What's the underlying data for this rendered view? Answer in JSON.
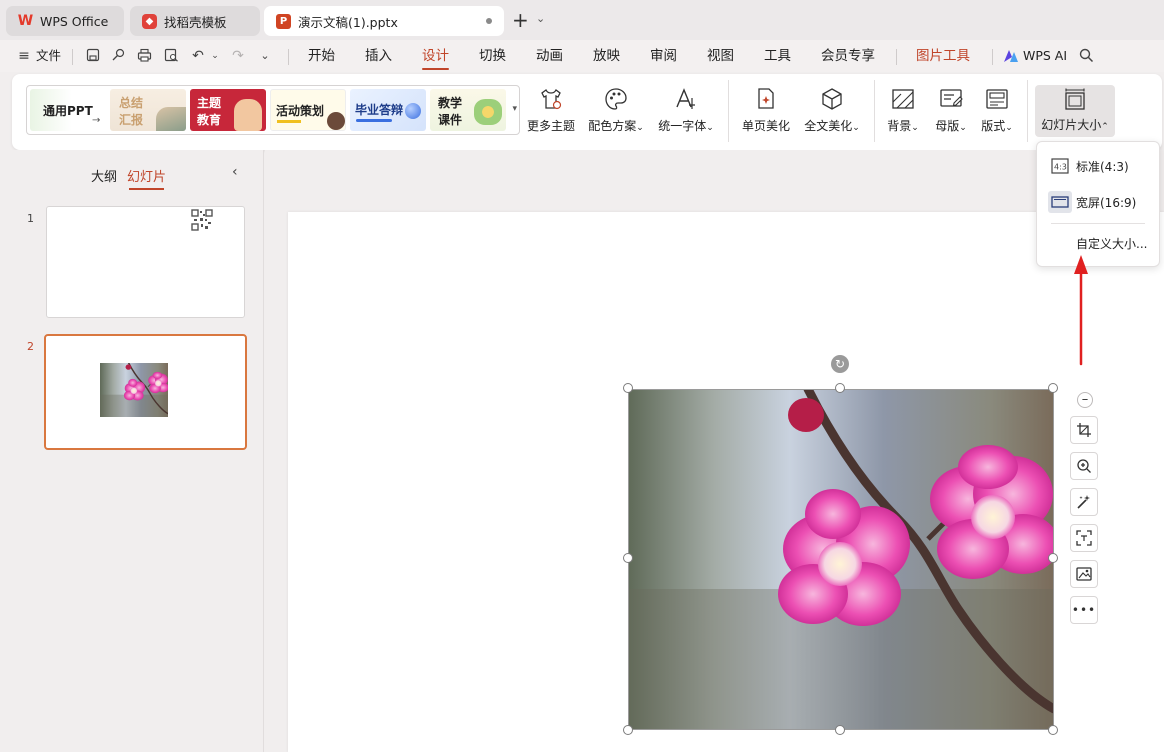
{
  "colors": {
    "accent": "#c0452a",
    "arrow": "#e02020",
    "wps_red": "#e43a2b",
    "pptx_red": "#d04423"
  },
  "tabs": [
    {
      "label": "WPS Office",
      "icon": "wps-logo-icon"
    },
    {
      "label": "找稻壳模板",
      "icon": "docer-icon"
    },
    {
      "label": "演示文稿(1).pptx",
      "icon": "presentation-file-icon"
    }
  ],
  "menu": {
    "file_label": "文件",
    "items": [
      "开始",
      "插入",
      "设计",
      "切换",
      "动画",
      "放映",
      "审阅",
      "视图",
      "工具",
      "会员专享",
      "图片工具"
    ],
    "active": "设计",
    "wps_ai": "WPS AI"
  },
  "ribbon": {
    "themes": [
      {
        "label": "通用PPT"
      },
      {
        "label1": "总结",
        "label2": "汇报"
      },
      {
        "label1": "主题",
        "label2": "教育"
      },
      {
        "label": "活动策划"
      },
      {
        "label": "毕业答辩"
      },
      {
        "label1": "教学",
        "label2": "课件"
      }
    ],
    "buttons": {
      "more_themes": "更多主题",
      "color_scheme": "配色方案",
      "unify_font": "统一字体",
      "page_beautify": "单页美化",
      "full_beautify": "全文美化",
      "background": "背景",
      "master": "母版",
      "layout": "版式",
      "slide_size": "幻灯片大小"
    }
  },
  "sidebar": {
    "tab_outline": "大纲",
    "tab_slides": "幻灯片",
    "slides": [
      {
        "number": "1"
      },
      {
        "number": "2"
      }
    ]
  },
  "dropdown": {
    "items": [
      {
        "label": "标准(4:3)",
        "icon": "ratio-4-3-icon"
      },
      {
        "label": "宽屏(16:9)",
        "icon": "widescreen-icon"
      },
      {
        "label": "自定义大小..."
      }
    ]
  }
}
